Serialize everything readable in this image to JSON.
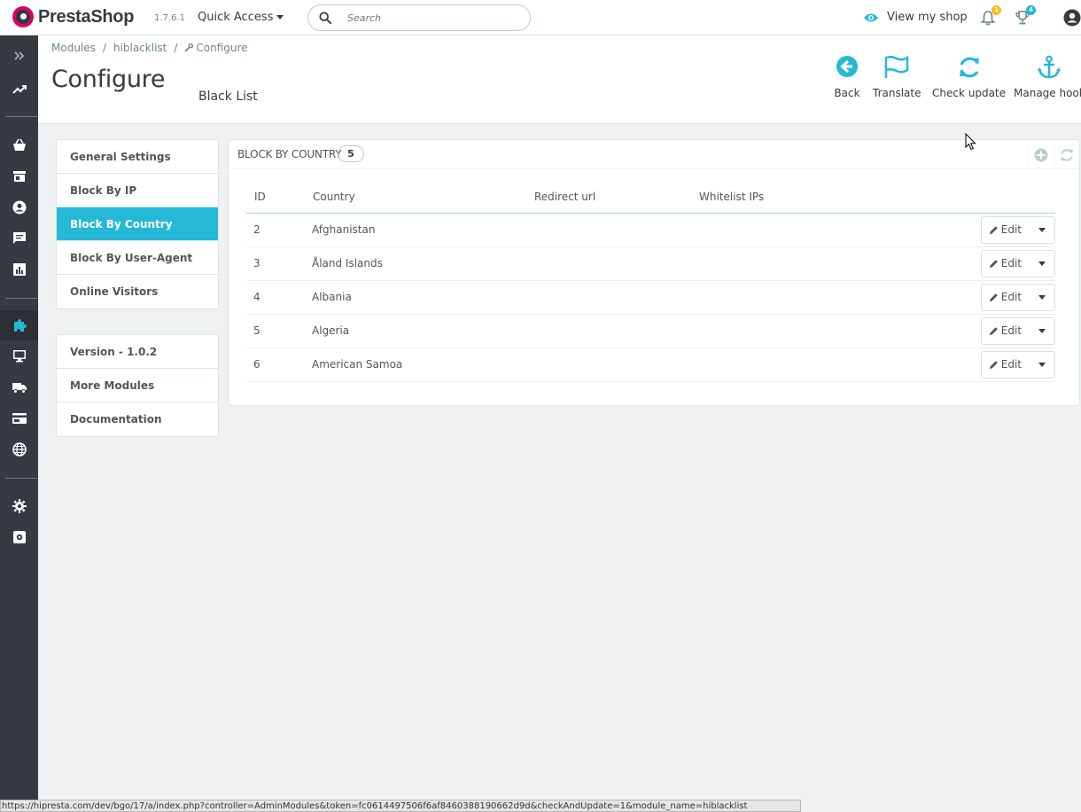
{
  "header": {
    "logo_text": "PrestaShop",
    "version": "1.7.6.1",
    "quick_access": "Quick Access",
    "search_placeholder": "Search",
    "view_shop": "View my shop",
    "notif_orders_count": "1",
    "notif_customers_count": "4"
  },
  "breadcrumb": {
    "item1": "Modules",
    "item2": "hiblacklist",
    "item3": "Configure",
    "separator": "/"
  },
  "page": {
    "title": "Configure",
    "subtitle": "Black List"
  },
  "toolbar": {
    "back": "Back",
    "translate": "Translate",
    "check_update": "Check update",
    "manage_hooks": "Manage hook"
  },
  "menu": {
    "items": [
      "General Settings",
      "Block By IP",
      "Block By Country",
      "Block By User-Agent",
      "Online Visitors"
    ],
    "active": "Block By Country"
  },
  "info_menu": {
    "items": [
      "Version - 1.0.2",
      "More Modules",
      "Documentation"
    ]
  },
  "panel": {
    "title": "BLOCK BY COUNTRY",
    "count": "5",
    "columns": [
      "ID",
      "Country",
      "Redirect url",
      "Whitelist IPs"
    ],
    "edit_label": "Edit",
    "rows": [
      {
        "id": "2",
        "country": "Afghanistan",
        "redirect": "",
        "whitelist": ""
      },
      {
        "id": "3",
        "country": "Åland Islands",
        "redirect": "",
        "whitelist": ""
      },
      {
        "id": "4",
        "country": "Albania",
        "redirect": "",
        "whitelist": ""
      },
      {
        "id": "5",
        "country": "Algeria",
        "redirect": "",
        "whitelist": ""
      },
      {
        "id": "6",
        "country": "American Samoa",
        "redirect": "",
        "whitelist": ""
      }
    ]
  },
  "status_bar": {
    "url": "https://hipresta.com/dev/bgo/17/a/index.php?controller=AdminModules&token=fc0614497506f6af8460388190662d9d&checkAndUpdate=1&module_name=hiblacklist"
  },
  "colors": {
    "accent": "#25b9d7",
    "sidebar": "#363a41",
    "brand_pink": "#df0067",
    "badge_orange": "#fbbb22"
  }
}
